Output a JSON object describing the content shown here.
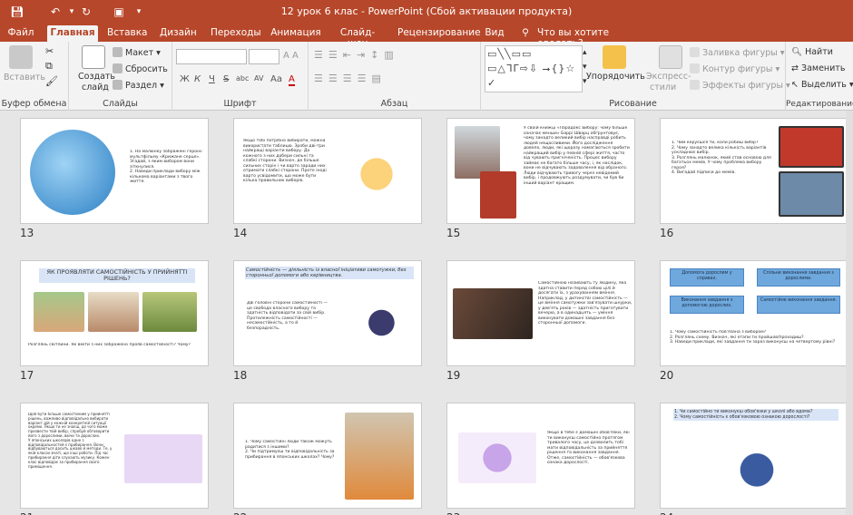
{
  "window": {
    "title": "12 урок 6 клас - PowerPoint (Сбой активации продукта)"
  },
  "colors": {
    "accent": "#b7472a",
    "ribbon": "#f3f3f3",
    "box": "#6fa8dc"
  },
  "tabs": [
    {
      "label": "Файл",
      "active": false
    },
    {
      "label": "Главная",
      "active": true
    },
    {
      "label": "Вставка",
      "active": false
    },
    {
      "label": "Дизайн",
      "active": false
    },
    {
      "label": "Переходы",
      "active": false
    },
    {
      "label": "Анимация",
      "active": false
    },
    {
      "label": "Слайд-шоу",
      "active": false
    },
    {
      "label": "Рецензирование",
      "active": false
    },
    {
      "label": "Вид",
      "active": false
    }
  ],
  "search": {
    "placeholder": "Что вы хотите сделать?"
  },
  "ribbon": {
    "clipboard": {
      "label": "Буфер обмена",
      "paste": "Вставить"
    },
    "slides": {
      "label": "Слайды",
      "create": "Создать",
      "create2": "слайд",
      "layout": "Макет",
      "reset": "Сбросить",
      "section": "Раздел"
    },
    "font": {
      "label": "Шрифт",
      "bold": "Ж",
      "italic": "К",
      "underline": "Ч",
      "strike": "S",
      "abc": "abc",
      "spacing": "AV",
      "case": "Aa",
      "color": "A"
    },
    "paragraph": {
      "label": "Абзац"
    },
    "drawing": {
      "label": "Рисование",
      "arrange": "Упорядочить",
      "styles": "Экспресс-",
      "styles2": "стили",
      "fill": "Заливка фигуры",
      "outline": "Контур фигуры",
      "effects": "Эффекты фигуры",
      "shapes_glyphs": "▭╲╲▭▭ ▭△ᒣᒥ⇨⇩ ⭢{}☆ ✓"
    },
    "editing": {
      "label": "Редактирование",
      "find": "Найти",
      "replace": "Заменить",
      "select": "Выделить"
    }
  },
  "slides": [
    {
      "number": "13",
      "text": "1. На малюнку зображені героїні мультфільму «Крижане серце». Згадай, з яким вибором вони зіткнулися.\n2. Наведи приклади вибору між кількома варіантами з твого життя."
    },
    {
      "number": "14",
      "text": "Якщо тобі потрібно вибирати, можна використати таблицю. Зроби дві-три найкращі варіанти вибору. До кожного з них добери сильні та слабкі сторони. Визнач, де більше сильних сторін і чи варто заради них отримати слабкі сторони. Проте іноді варто усвідомити, що може бути кілька правильних виборів."
    },
    {
      "number": "15",
      "text": "У своїй книжці «Парадокс вибору: чому більше означає менше» Баррі Шварц обґрунтовує, чому занадто великий вибір насправді робить людей нещасливими. Його дослідження довело, люди, які щоразу намагаються зробити найкращий вибір у певній сфері життя, часто від чувають пригніченість. Процес вибору займає не багато більше часу, і, як наслідок, вони не відчувають задоволення від обраного. Люди відчувають тривогу через невідомий вибір, і продовжують роздумувати, чи був би інший варіант кращим."
    },
    {
      "number": "16",
      "text": "1. Чим керуєшся ти, коли робиш вибір?\n2. Чому занадто велика кількість варіантів ускладнює вибір.\n3. Розглянь малюнок, який став основою для багатьох мемів. У чому проблема вибору героя?\n4. Вигадай підписи до мемів."
    },
    {
      "number": "17",
      "title": "ЯК ПРОЯВЛЯТИ САМОСТІЙНІСТЬ У ПРИЙНЯТТІ РІШЕНЬ?",
      "text": "Розглянь світлини. Як вміти з них зображено прояв самостійності? Чому?"
    },
    {
      "number": "18",
      "title": "Самостійність — діяльність із власної ініціативи самотужки, без сторонньої допомоги або керівництва.",
      "text": "Дві головні сторони самостійності — це свобода власного вибору та здатність відповідати за свій вибір. Протилежність самостійності — несамостійність, а то й безпорадність."
    },
    {
      "number": "19",
      "text": "Самостійною називають ту людину, яка здатна ставити перед собою цілі й досягати їх, з урахуванням вміння. Наприклад, у дитинстві самостійність — це вміння самотужки зав'язувати шнурки, у дев'ять років — здатність приготувати вечерю, а в одинадцять — уміння виконувати домашні завдання без сторонньої допомоги."
    },
    {
      "number": "20",
      "boxes": [
        "Допомога дорослим у справах.",
        "Спільне виконання завдання з дорослими.",
        "Виконання завдання з допомогою дорослих.",
        "Самостійне виконання завдання."
      ],
      "text": "1. Чому самостійність пов'язана з вибором?\n2. Розглянь схему. Визнач, які етапи ти пройшов/проходиш?\n3. Наведи приклади, які завдання ти зараз виконуєш на четвертому рівні?"
    },
    {
      "number": "21",
      "text": "Щоб бути більше самостійним у прийнятті рішень, важливо відповідально вибирати варіант дій у кожній конкретній ситуації окремо. Якщо ти не знаєш, до чого може призвести твій вибір, спробуй обговорити його з дорослими, ввічи та дорослих.\nУ японських школярів одне з відповідальностей є прибирання. Вони відбуваються досить цікаво й методи. Те, у якій класах вчаті, ще інші роботи. Під час прибирання діти слухають музику. Кожен клас відповідає за прибирання свого приміщення."
    },
    {
      "number": "22",
      "text": "1. Чому самостійні люди також можуть радитися з іншими?\n2. Чи підтримуєш ти відповідальність за прибирання в японських школах? Чому?"
    },
    {
      "number": "23",
      "text": "Якщо в тебе є домашні обов'язки, які ти виконуєш самостійно протягом тривалого часу, це дозволить тобі мати відповідальність за прийняття рішення та виконання завдання. Отже, самостійність — обов'язкова ознака дорослості."
    },
    {
      "number": "24",
      "text": "1. Чи самостійно ти виконуєш обов'язки у школі або вдома?\n2. Чому самостійність є обов'язковою ознакою дорослості?"
    }
  ]
}
